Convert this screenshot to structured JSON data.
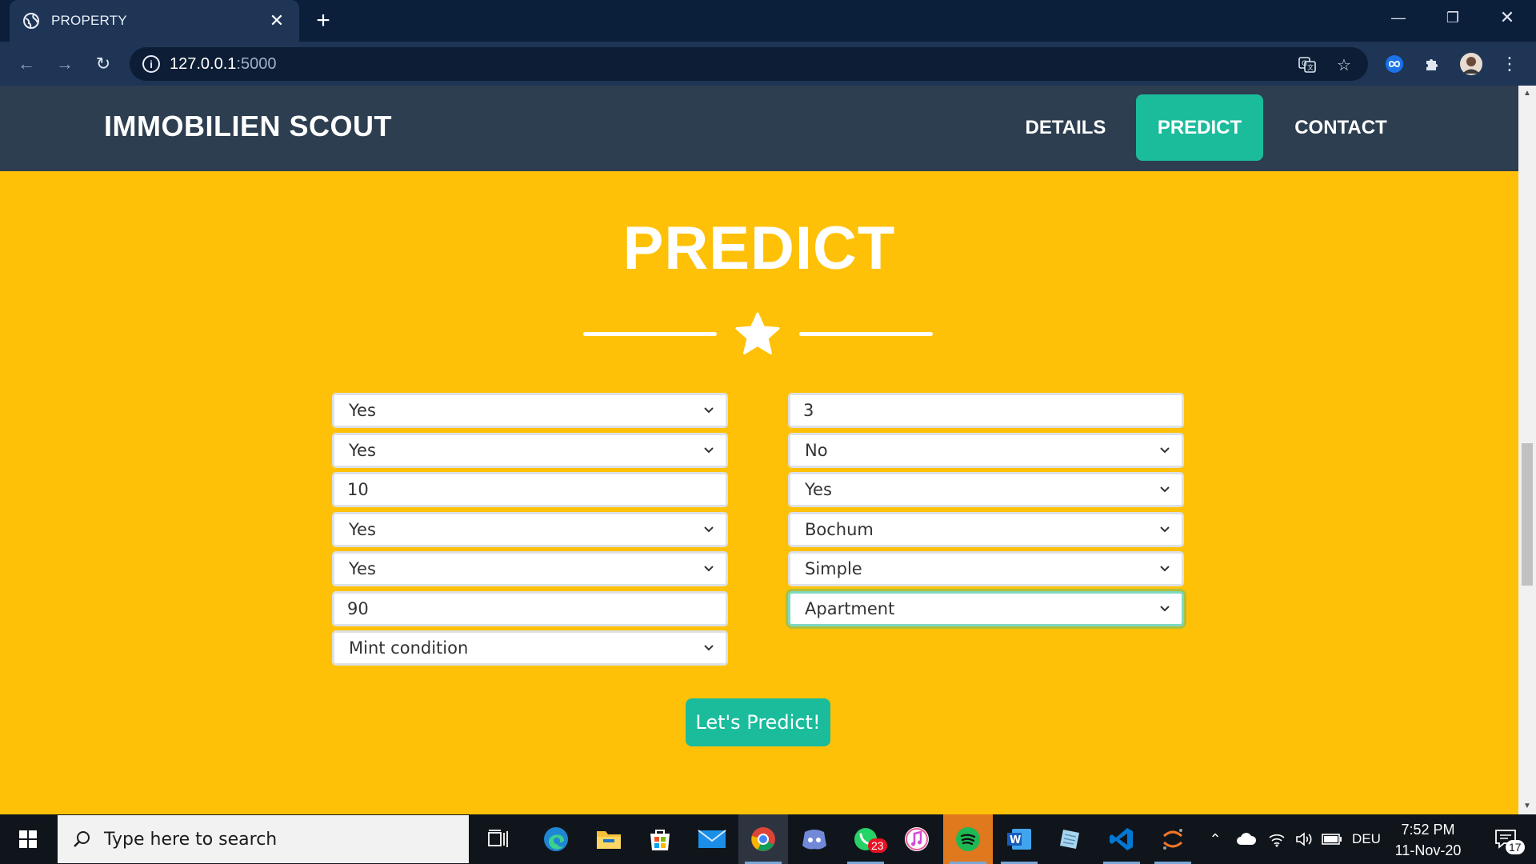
{
  "browser": {
    "tab_title": "PROPERTY",
    "url_host": "127.0.0.1",
    "url_port": ":5000"
  },
  "site": {
    "brand": "IMMOBILIEN SCOUT",
    "nav": [
      "DETAILS",
      "PREDICT",
      "CONTACT"
    ],
    "active_nav": "PREDICT"
  },
  "form": {
    "title": "PREDICT",
    "left_fields": [
      {
        "type": "select",
        "value": "Yes"
      },
      {
        "type": "select",
        "value": "Yes"
      },
      {
        "type": "input",
        "value": "10"
      },
      {
        "type": "select",
        "value": "Yes"
      },
      {
        "type": "select",
        "value": "Yes"
      },
      {
        "type": "input",
        "value": "90"
      },
      {
        "type": "select",
        "value": "Mint condition"
      }
    ],
    "right_fields": [
      {
        "type": "input",
        "value": "3"
      },
      {
        "type": "select",
        "value": "No"
      },
      {
        "type": "select",
        "value": "Yes"
      },
      {
        "type": "select",
        "value": "Bochum"
      },
      {
        "type": "select",
        "value": "Simple"
      },
      {
        "type": "select",
        "value": "Apartment",
        "focused": true
      }
    ],
    "submit_label": "Let's Predict!"
  },
  "taskbar": {
    "search_placeholder": "Type here to search",
    "whatsapp_badge": "23",
    "language": "DEU",
    "time": "7:52 PM",
    "date": "11-Nov-20",
    "notifications": "17"
  },
  "colors": {
    "page_bg": "#ffc107",
    "nav_bg": "#2c3e50",
    "accent": "#1abc9c"
  }
}
